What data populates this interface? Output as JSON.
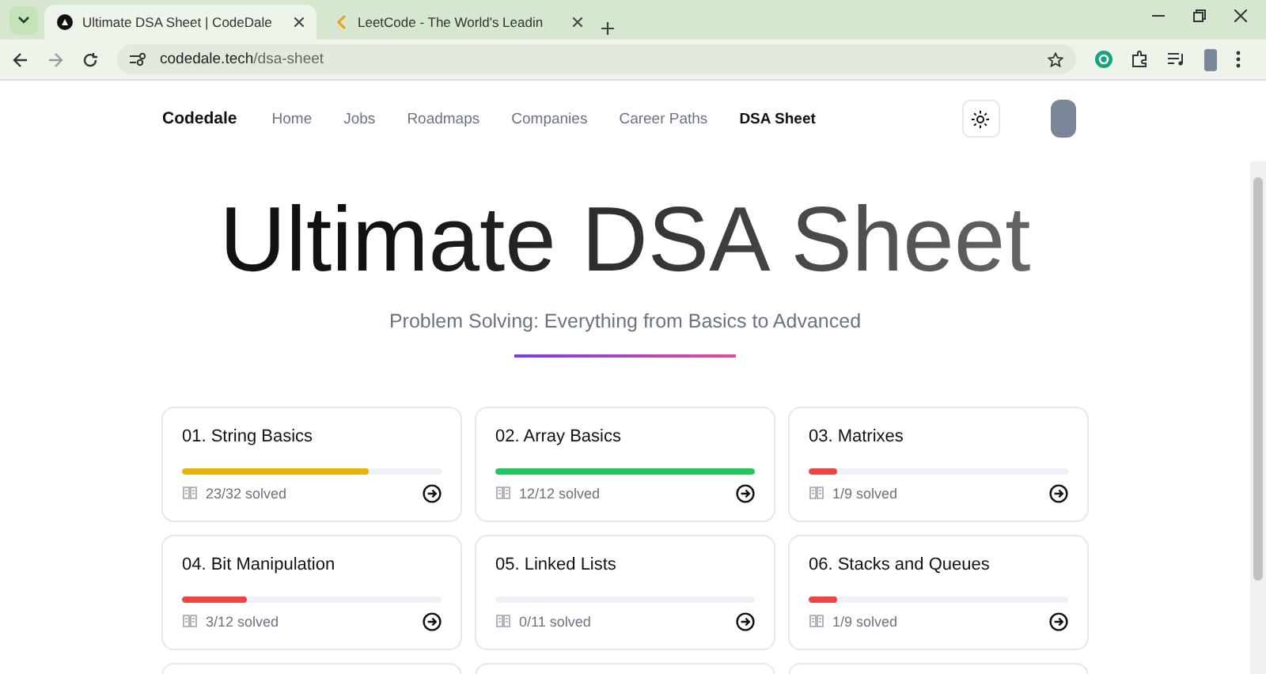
{
  "browser": {
    "tabs": [
      {
        "title": "Ultimate DSA Sheet | CodeDale",
        "selected": true
      },
      {
        "title": "LeetCode - The World's Leadin",
        "selected": false
      }
    ],
    "url_host": "codedale.tech",
    "url_path": "/dsa-sheet"
  },
  "nav": {
    "brand": "Codedale",
    "links": [
      {
        "label": "Home",
        "selected": false
      },
      {
        "label": "Jobs",
        "selected": false
      },
      {
        "label": "Roadmaps",
        "selected": false
      },
      {
        "label": "Companies",
        "selected": false
      },
      {
        "label": "Career Paths",
        "selected": false
      },
      {
        "label": "DSA Sheet",
        "selected": true
      }
    ]
  },
  "hero": {
    "title": "Ultimate DSA Sheet",
    "subtitle": "Problem Solving: Everything from Basics to Advanced"
  },
  "topics": [
    {
      "title": "01. String Basics",
      "level": 0.72,
      "color": "#eab308",
      "progress": "23/32 solved"
    },
    {
      "title": "02. Array Basics",
      "level": 1,
      "color": "#22c55e",
      "progress": "12/12 solved"
    },
    {
      "title": "03. Matrixes",
      "level": 0.11,
      "color": "#ef4444",
      "progress": "1/9 solved"
    },
    {
      "title": "04. Bit Manipulation",
      "level": 0.25,
      "color": "#ef4444",
      "progress": "3/12 solved"
    },
    {
      "title": "05. Linked Lists",
      "level": 0,
      "progress": "0/11 solved"
    },
    {
      "title": "06. Stacks and Queues",
      "level": 0.11,
      "color": "#ef4444",
      "progress": "1/9 solved"
    }
  ]
}
